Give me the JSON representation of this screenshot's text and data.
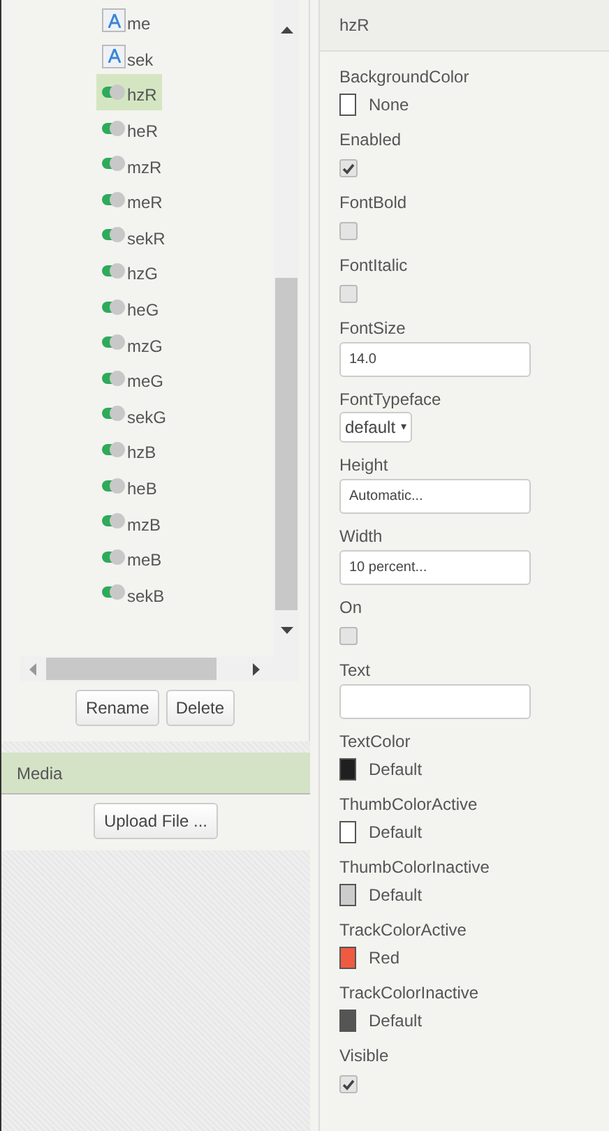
{
  "components": [
    {
      "name": "me",
      "kind": "label",
      "selected": false
    },
    {
      "name": "sek",
      "kind": "label",
      "selected": false
    },
    {
      "name": "hzR",
      "kind": "switch",
      "selected": true
    },
    {
      "name": "heR",
      "kind": "switch",
      "selected": false
    },
    {
      "name": "mzR",
      "kind": "switch",
      "selected": false
    },
    {
      "name": "meR",
      "kind": "switch",
      "selected": false
    },
    {
      "name": "sekR",
      "kind": "switch",
      "selected": false
    },
    {
      "name": "hzG",
      "kind": "switch",
      "selected": false
    },
    {
      "name": "heG",
      "kind": "switch",
      "selected": false
    },
    {
      "name": "mzG",
      "kind": "switch",
      "selected": false
    },
    {
      "name": "meG",
      "kind": "switch",
      "selected": false
    },
    {
      "name": "sekG",
      "kind": "switch",
      "selected": false
    },
    {
      "name": "hzB",
      "kind": "switch",
      "selected": false
    },
    {
      "name": "heB",
      "kind": "switch",
      "selected": false
    },
    {
      "name": "mzB",
      "kind": "switch",
      "selected": false
    },
    {
      "name": "meB",
      "kind": "switch",
      "selected": false
    },
    {
      "name": "sekB",
      "kind": "switch",
      "selected": false
    }
  ],
  "component_buttons": [
    "Rename",
    "Delete"
  ],
  "media": {
    "title": "Media",
    "button": "Upload File ..."
  },
  "properties": {
    "title": "hzR",
    "items": [
      {
        "label": "BackgroundColor",
        "kind": "color",
        "color": "#ffffff",
        "value": "None"
      },
      {
        "label": "Enabled",
        "kind": "checkbox",
        "checked": true
      },
      {
        "label": "FontBold",
        "kind": "checkbox",
        "checked": false
      },
      {
        "label": "FontItalic",
        "kind": "checkbox",
        "checked": false
      },
      {
        "label": "FontSize",
        "kind": "text",
        "value": "14.0"
      },
      {
        "label": "FontTypeface",
        "kind": "dropdown",
        "value": "default",
        "caret": "▾"
      },
      {
        "label": "Height",
        "kind": "text",
        "value": "Automatic..."
      },
      {
        "label": "Width",
        "kind": "text",
        "value": "10 percent..."
      },
      {
        "label": "On",
        "kind": "checkbox",
        "checked": false
      },
      {
        "label": "Text",
        "kind": "text"
      },
      {
        "label": "TextColor",
        "kind": "color",
        "color": "#1f1f1f",
        "value": "Default"
      },
      {
        "label": "ThumbColorActive",
        "kind": "color",
        "color": "#ffffff",
        "value": "Default"
      },
      {
        "label": "ThumbColorInactive",
        "kind": "color",
        "color": "#cccccc",
        "value": "Default"
      },
      {
        "label": "TrackColorActive",
        "kind": "color",
        "color": "#f05a40",
        "value": "Red"
      },
      {
        "label": "TrackColorInactive",
        "kind": "color",
        "color": "#555555",
        "value": "Default"
      },
      {
        "label": "Visible",
        "kind": "checkbox",
        "checked": true
      }
    ]
  }
}
